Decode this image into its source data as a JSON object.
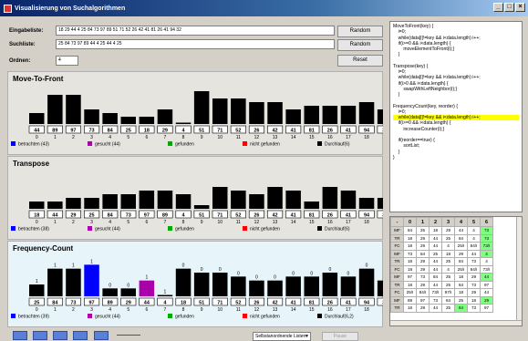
{
  "window": {
    "title": "Visualisierung von Suchalgorithmen",
    "min": "_",
    "max": "□",
    "close": "×"
  },
  "controls": {
    "input_label": "Eingabeliste:",
    "input_value": "18 29 44 4 25 84 73 97 89 51 71 52 26 42 41 81 26 41 94 32",
    "search_label": "Suchliste:",
    "search_value": "25 84 73 97 89 44 4 25 44 4 25",
    "orders_label": "Ordnen:",
    "orders_value": "4",
    "random1": "Random",
    "random2": "Random",
    "reset": "Reset"
  },
  "panels": [
    {
      "title": "Move-To-Front",
      "bars": [
        3,
        8,
        8,
        4,
        3,
        2,
        2,
        4,
        0,
        9,
        7,
        7,
        6,
        6,
        4,
        5,
        5,
        5,
        6,
        4
      ],
      "labels": [
        "44",
        "89",
        "97",
        "73",
        "84",
        "25",
        "18",
        "29",
        "4",
        "51",
        "71",
        "52",
        "26",
        "42",
        "41",
        "81",
        "26",
        "41",
        "94",
        "32"
      ],
      "counts": [],
      "highlight": {},
      "legend": [
        "betrachten (43)",
        "gesucht (44)",
        "gefunden",
        "nicht gefunden",
        "Durchlauf(6)"
      ]
    },
    {
      "title": "Transpose",
      "bars": [
        2,
        2,
        3,
        3,
        4,
        4,
        5,
        5,
        4,
        1,
        6,
        5,
        4,
        6,
        5,
        2,
        6,
        5,
        3,
        3
      ],
      "labels": [
        "18",
        "44",
        "29",
        "25",
        "84",
        "73",
        "97",
        "89",
        "4",
        "51",
        "71",
        "52",
        "26",
        "42",
        "41",
        "81",
        "26",
        "41",
        "94",
        "32"
      ],
      "counts": [],
      "highlight": {},
      "legend": [
        "betrachten (38)",
        "gesucht (44)",
        "gefunden",
        "nicht gefunden",
        "Durchlauf(6)"
      ]
    },
    {
      "title": "Frequency-Count",
      "bars": [
        3,
        7,
        7,
        8,
        2,
        2,
        4,
        0,
        7,
        6,
        6,
        5,
        4,
        4,
        5,
        5,
        6,
        5,
        7,
        4
      ],
      "labels": [
        "25",
        "84",
        "73",
        "97",
        "89",
        "29",
        "44",
        "4",
        "18",
        "51",
        "71",
        "52",
        "26",
        "42",
        "41",
        "81",
        "26",
        "41",
        "94",
        "32"
      ],
      "counts": [
        "1",
        "1",
        "1",
        "1",
        "0",
        "0",
        "1",
        "1",
        "0",
        "0",
        "0",
        "0",
        "0",
        "0",
        "0",
        "0",
        "0",
        "0",
        "0",
        "0"
      ],
      "highlight": {
        "3": "#0000ff",
        "6": "#aa00aa"
      },
      "legend": [
        "betrachten (39)",
        "gesucht (44)",
        "gefunden",
        "nicht gefunden",
        "Durchlauf(6,2)"
      ]
    }
  ],
  "indices": [
    "0",
    "1",
    "2",
    "3",
    "4",
    "5",
    "6",
    "7",
    "8",
    "9",
    "10",
    "11",
    "12",
    "13",
    "14",
    "15",
    "16",
    "17",
    "18",
    "19"
  ],
  "legend_colors": [
    "#0000ff",
    "#aa00aa",
    "#00aa00",
    "#ff0000",
    "#000000"
  ],
  "code_lines": [
    {
      "t": "MoveToFront(key) {",
      "hl": false
    },
    {
      "t": "    i=0;",
      "hl": false
    },
    {
      "t": "    while(data[i]!=key && i<data.length) i++;",
      "hl": false
    },
    {
      "t": "    if(i>=0 && i<data.length) {",
      "hl": false
    },
    {
      "t": "        moveElementToFront(i);}",
      "hl": false
    },
    {
      "t": "    }",
      "hl": false
    },
    {
      "t": "",
      "hl": false
    },
    {
      "t": "Transpose(key) {",
      "hl": false
    },
    {
      "t": "    i=0;",
      "hl": false
    },
    {
      "t": "    while(data[i]!=key && i<data.length) i++;",
      "hl": false
    },
    {
      "t": "    if(i>0 && i<data.length) {",
      "hl": false
    },
    {
      "t": "        swapWithLeftNeighbor(i);}",
      "hl": false
    },
    {
      "t": "    }",
      "hl": false
    },
    {
      "t": "",
      "hl": false
    },
    {
      "t": "FrequencyCount(key, reorder) {",
      "hl": false
    },
    {
      "t": "    i=0;",
      "hl": false
    },
    {
      "t": "    while(data[i]!=key && i<data.length) i++;",
      "hl": true
    },
    {
      "t": "    if(i>=0 && i<data.length) {",
      "hl": false
    },
    {
      "t": "        increaseCounter(i);}",
      "hl": false
    },
    {
      "t": "",
      "hl": false
    },
    {
      "t": "    if(reorder==true) {",
      "hl": false
    },
    {
      "t": "        sortList;",
      "hl": false
    },
    {
      "t": "    }",
      "hl": false
    },
    {
      "t": "}",
      "hl": false
    }
  ],
  "table": {
    "headers": [
      "-",
      "0",
      "1",
      "2",
      "3",
      "4",
      "5",
      "6"
    ],
    "rows": [
      [
        "MF",
        "84",
        "25",
        "18",
        "29",
        "44",
        "4",
        "73"
      ],
      [
        "TR",
        "18",
        "29",
        "44",
        "25",
        "84",
        "4",
        "73"
      ],
      [
        "FC",
        "18",
        "29",
        "44",
        "4",
        "25/I",
        "84/I",
        "73/I"
      ],
      [
        "MF",
        "73",
        "84",
        "25",
        "18",
        "29",
        "44",
        "4"
      ],
      [
        "TR",
        "18",
        "29",
        "44",
        "25",
        "84",
        "73",
        "4"
      ],
      [
        "FC",
        "18",
        "29",
        "44",
        "4",
        "25/I",
        "84/I",
        "73/I"
      ],
      [
        "MF",
        "97",
        "73",
        "84",
        "25",
        "18",
        "29",
        "44"
      ],
      [
        "TR",
        "18",
        "29",
        "44",
        "25",
        "84",
        "73",
        "97"
      ],
      [
        "FC",
        "25/I",
        "84/I",
        "73/I",
        "97/I",
        "18",
        "29",
        "44"
      ],
      [
        "MF",
        "89",
        "97",
        "73",
        "84",
        "25",
        "18",
        "29"
      ],
      [
        "TR",
        "18",
        "29",
        "44",
        "25",
        "84",
        "73",
        "97"
      ]
    ],
    "green": [
      [
        0,
        7
      ],
      [
        1,
        7
      ],
      [
        2,
        7
      ],
      [
        3,
        7
      ],
      [
        6,
        7
      ],
      [
        9,
        7
      ],
      [
        10,
        5
      ]
    ]
  },
  "bottom": {
    "select_value": "Selbstanordnende Listen",
    "select_arrow": "▼",
    "pause_label": "Pause"
  }
}
